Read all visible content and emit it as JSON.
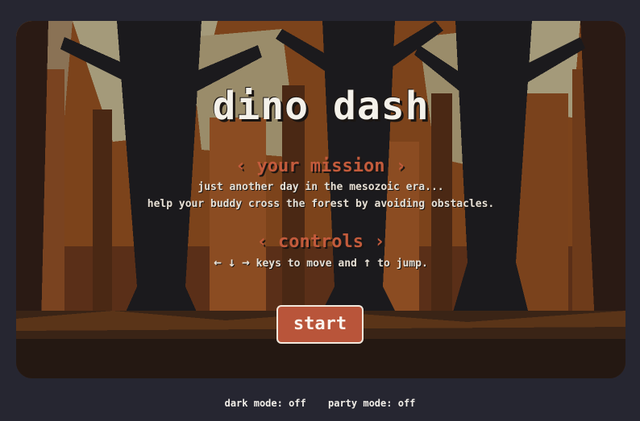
{
  "game": {
    "title": "dino dash"
  },
  "mission": {
    "heading": "‹ your mission ›",
    "line1": "just another day in the mesozoic era...",
    "line2": "help your buddy cross the forest by avoiding obstacles."
  },
  "controls": {
    "heading": "‹ controls ›",
    "left_arrow": "←",
    "down_arrow": "↓",
    "right_arrow": "→",
    "move_text": "keys to move and",
    "up_arrow": "↑",
    "jump_text": "to jump."
  },
  "start_button": {
    "label": "start"
  },
  "footer": {
    "dark_mode_label": "dark mode:",
    "dark_mode_value": "off",
    "party_mode_label": "party mode:",
    "party_mode_value": "off"
  },
  "colors": {
    "page_background": "#262631",
    "heading_accent": "#c35b3c",
    "button_fill": "#b9553a",
    "title_text": "#f4f1ea",
    "forest_sky": "#a49a7a",
    "forest_mid": "#7c431b",
    "tree_trunk": "#1b1a1d"
  }
}
